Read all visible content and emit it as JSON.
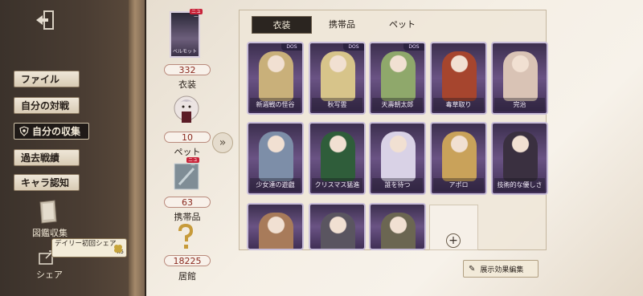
{
  "sidebar": {
    "items": [
      {
        "label": "ファイル"
      },
      {
        "label": "自分の対戦"
      },
      {
        "label": "自分の収集"
      },
      {
        "label": "過去戦績"
      },
      {
        "label": "キャラ認知"
      }
    ],
    "book_label": "図鑑収集",
    "share_label": "シェア",
    "bubble_text": "デイリー初回シェア",
    "bubble_suffix": "x5"
  },
  "stats": {
    "character_name": "ベルモット",
    "costume_count": "332",
    "costume_label": "衣装",
    "pet_count": "10",
    "pet_label": "ペット",
    "accessory_count": "63",
    "accessory_label": "携帯品",
    "mansion_count": "18225",
    "mansion_label": "居館",
    "new_badge": "ニュー"
  },
  "tabs": [
    {
      "label": "衣装"
    },
    {
      "label": "携帯品"
    },
    {
      "label": "ペット"
    }
  ],
  "cards": [
    {
      "caption": "新週戦の怪谷",
      "tag": "DOS"
    },
    {
      "caption": "秋写雲",
      "tag": "DOS"
    },
    {
      "caption": "天壽朝太郎",
      "tag": "DOS"
    },
    {
      "caption": "毒草取り",
      "tag": ""
    },
    {
      "caption": "完治",
      "tag": ""
    },
    {
      "caption": "少女達の遊戯",
      "tag": ""
    },
    {
      "caption": "クリスマス猛進",
      "tag": ""
    },
    {
      "caption": "誰を待つ",
      "tag": ""
    },
    {
      "caption": "アポロ",
      "tag": ""
    },
    {
      "caption": "技術的な優しさ",
      "tag": ""
    },
    {
      "caption": "",
      "tag": ""
    },
    {
      "caption": "",
      "tag": ""
    },
    {
      "caption": "",
      "tag": ""
    }
  ],
  "edit_button_label": "展示効果編集",
  "colors": {
    "card_purple": "#6a5384",
    "accent_red": "#8a2a1f",
    "panel_bg": "#f5efe5"
  }
}
